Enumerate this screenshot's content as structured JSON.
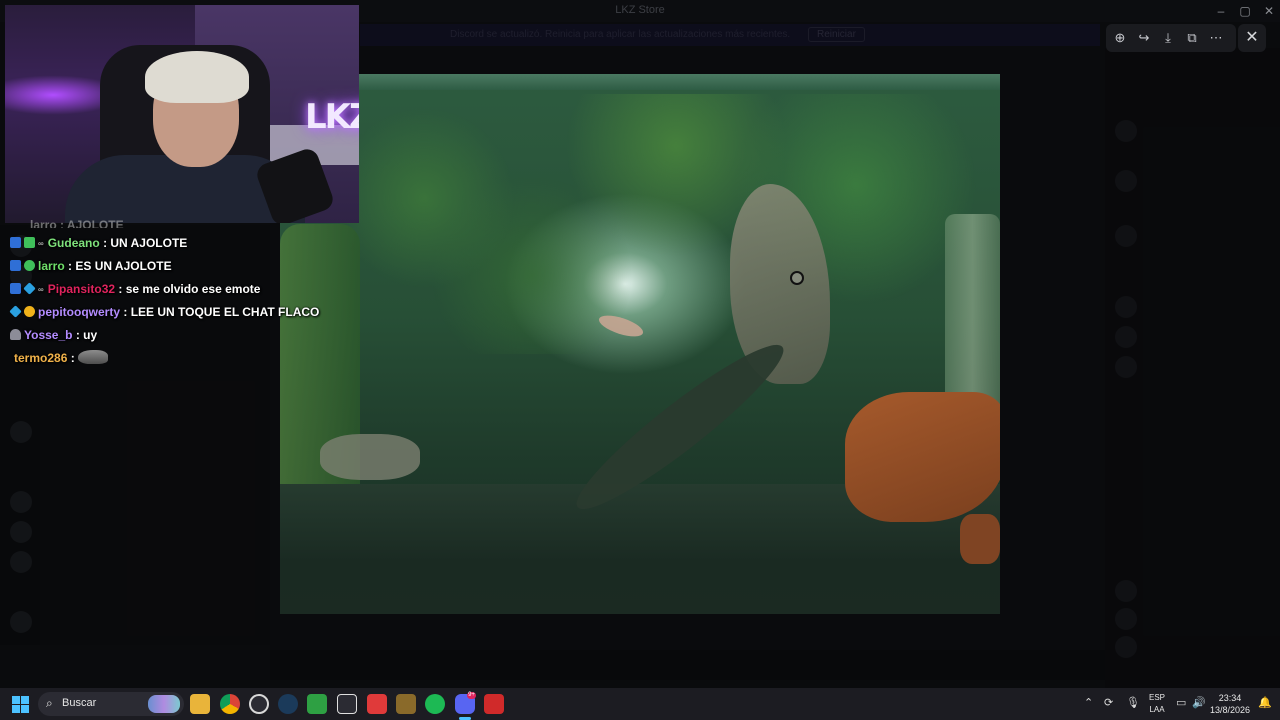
{
  "window": {
    "title": "LKZ Store"
  },
  "notice": {
    "text": "Discord se actualizó. Reinicia para aplicar las actualizaciones más recientes.",
    "button": "Reiniciar"
  },
  "viewer": {
    "toolbar": [
      {
        "name": "zoom-icon",
        "glyph": "⊕"
      },
      {
        "name": "forward-icon",
        "glyph": "↪"
      },
      {
        "name": "download-icon",
        "glyph": "⤓"
      },
      {
        "name": "open-external-icon",
        "glyph": "⧉"
      },
      {
        "name": "more-icon",
        "glyph": "⋯"
      }
    ],
    "close_glyph": "✕"
  },
  "webcam": {
    "neon_text": "LKZ"
  },
  "chat": {
    "partial_top": "larro : AJOLOTE",
    "messages": [
      {
        "user": "Gudeano",
        "color": "#7ee17b",
        "text": ": UN AJOLOTE",
        "badges": [
          "blue",
          "green",
          "sub"
        ]
      },
      {
        "user": "larro",
        "color": "#6fe06a",
        "text": ": ES UN AJOLOTE",
        "badges": [
          "blue",
          "check"
        ]
      },
      {
        "user": "Pipansito32",
        "color": "#e0245e",
        "text": ": se me olvido ese emote",
        "badges": [
          "blue",
          "cyan",
          "sub"
        ]
      },
      {
        "user": "pepitooqwerty",
        "color": "#b38cff",
        "text": ": LEE UN TOQUE EL CHAT FLACO",
        "badges": [
          "cyan",
          "gold"
        ]
      },
      {
        "user": "Yosse_b",
        "color": "#b38cff",
        "text": ": uy",
        "badges": [
          "grey"
        ]
      },
      {
        "user": "termo286",
        "color": "#f0b24a",
        "text": ":",
        "badges": [],
        "emote": true
      }
    ]
  },
  "taskbar": {
    "search_label": "Buscar",
    "lang_top": "ESP",
    "lang_bottom": "LAA",
    "time": "23:34",
    "date": "13/8/2026",
    "discord_badge": "9+"
  }
}
